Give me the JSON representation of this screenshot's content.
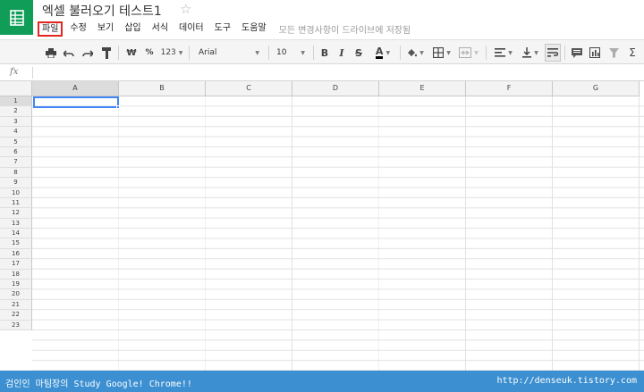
{
  "header": {
    "title": "엑셀 불러오기 테스트1",
    "menu": [
      "파일",
      "수정",
      "보기",
      "삽입",
      "서식",
      "데이터",
      "도구",
      "도움말"
    ],
    "save_status": "모든 변경사항이 드라이브에 저장됨"
  },
  "toolbar": {
    "currency_label": "₩",
    "percent_label": "%",
    "number_format_label": "123",
    "font_name": "Arial",
    "font_size": "10",
    "bold_label": "B",
    "italic_label": "I",
    "strike_label": "S",
    "text_color_label": "A",
    "function_label": "Σ",
    "text_color_value": "#000000"
  },
  "formula_bar": {
    "fx_label": "fx",
    "value": ""
  },
  "grid": {
    "columns": [
      "A",
      "B",
      "C",
      "D",
      "E",
      "F",
      "G"
    ],
    "rows": [
      "1",
      "2",
      "3",
      "4",
      "5",
      "6",
      "7",
      "8",
      "9",
      "10",
      "11",
      "12",
      "13",
      "14",
      "15",
      "16",
      "17",
      "18",
      "19",
      "20",
      "21",
      "22",
      "23"
    ],
    "selected_cell": "A1"
  },
  "footer": {
    "left_text": "검인인 마팀장의 Study Google! Chrome!!",
    "right_text": "http://denseuk.tistory.com"
  },
  "colors": {
    "brand": "#0f9d58",
    "highlight": "#e52620",
    "selection": "#4285f4",
    "footer_bg": "#3c8fd0"
  }
}
